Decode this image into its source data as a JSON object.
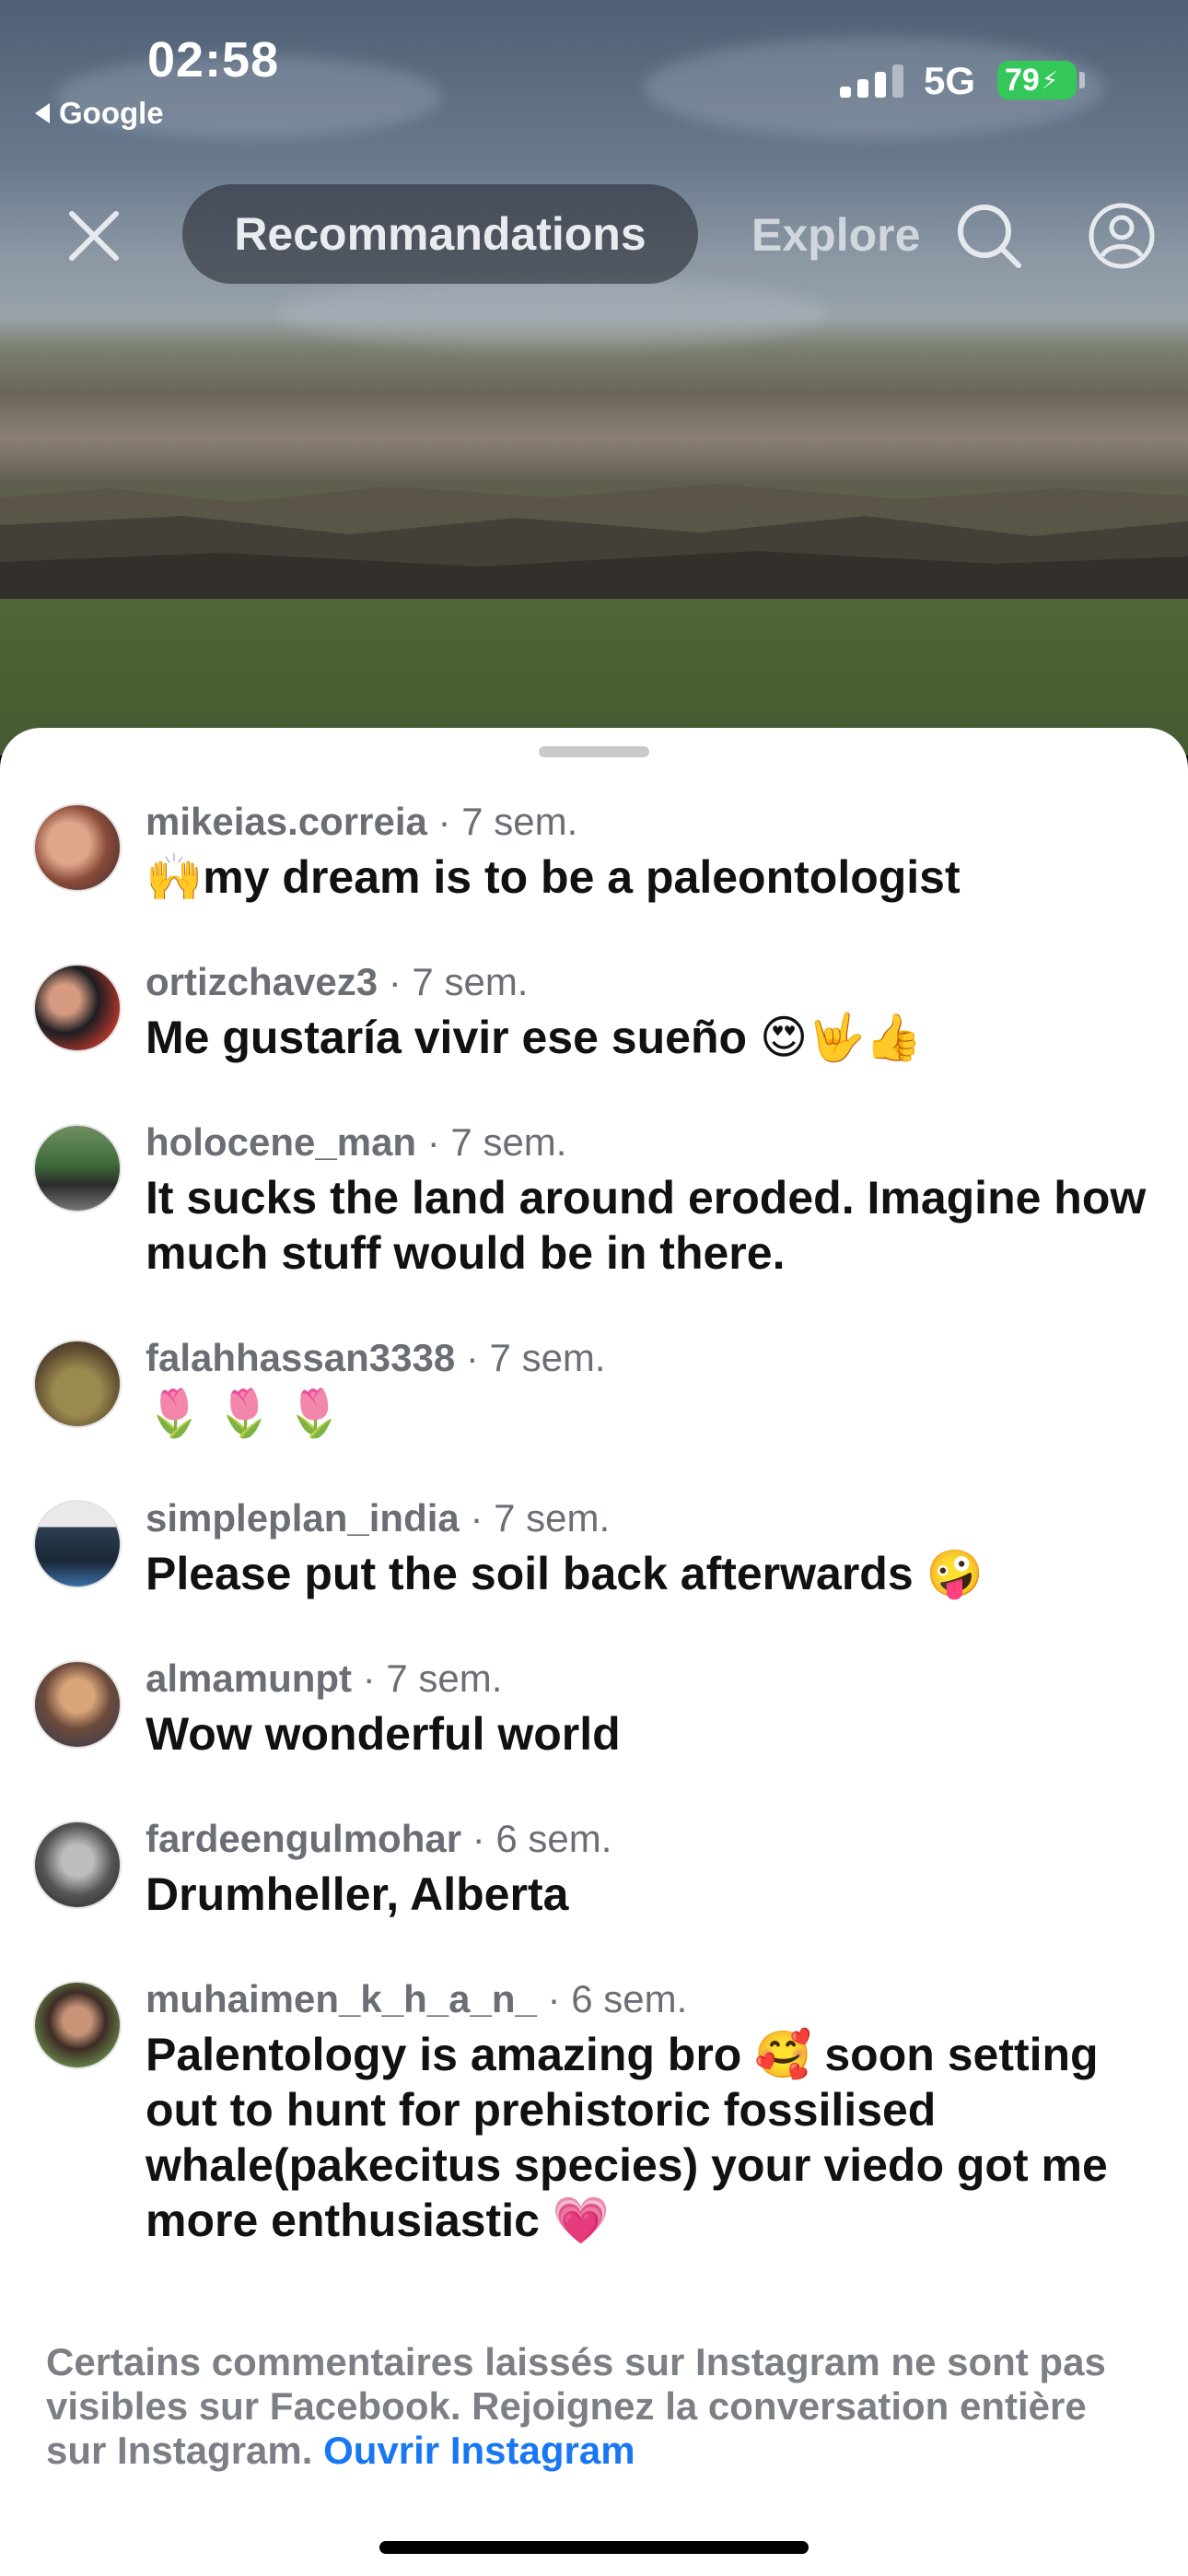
{
  "status_bar": {
    "time": "02:58",
    "back_label": "Google",
    "network": "5G",
    "battery_level": "79",
    "battery_color": "#34c759"
  },
  "nav": {
    "close_icon": "close-icon",
    "active_tab": "Recommandations",
    "other_tab": "Explorer",
    "search_icon": "search-icon",
    "profile_icon": "profile-icon"
  },
  "comments": [
    {
      "user": "mikeias.correia",
      "time": "· 7 sem.",
      "text": "🙌my dream is to be a paleontologist"
    },
    {
      "user": "ortizchavez3",
      "time": "· 7 sem.",
      "text": "Me gustaría vivir ese sueño 😍🤟👍"
    },
    {
      "user": "holocene_man",
      "time": "· 7 sem.",
      "text": "It sucks the land around eroded. Imagine how much stuff would be in there."
    },
    {
      "user": "falahhassan3338",
      "time": "· 7 sem.",
      "text": "🌷 🌷 🌷"
    },
    {
      "user": "simpleplan_india",
      "time": "· 7 sem.",
      "text": "Please put the soil back afterwards 🤪"
    },
    {
      "user": "almamunpt",
      "time": "· 7 sem.",
      "text": "Wow wonderful world"
    },
    {
      "user": "fardeengulmohar",
      "time": "· 6 sem.",
      "text": "Drumheller, Alberta"
    },
    {
      "user": "muhaimen_k_h_a_n_",
      "time": "· 6 sem.",
      "text": "Palentology is amazing bro 🥰 soon setting out to hunt for prehistoric fossilised whale(pakecitus species) your viedo got me more enthusiastic 💗"
    }
  ],
  "footer": {
    "note": "Certains commentaires laissés sur Instagram ne sont pas visibles sur Facebook. Rejoignez la conversation entière sur Instagram.",
    "link": "Ouvrir Instagram",
    "link_color": "#1877f2"
  }
}
